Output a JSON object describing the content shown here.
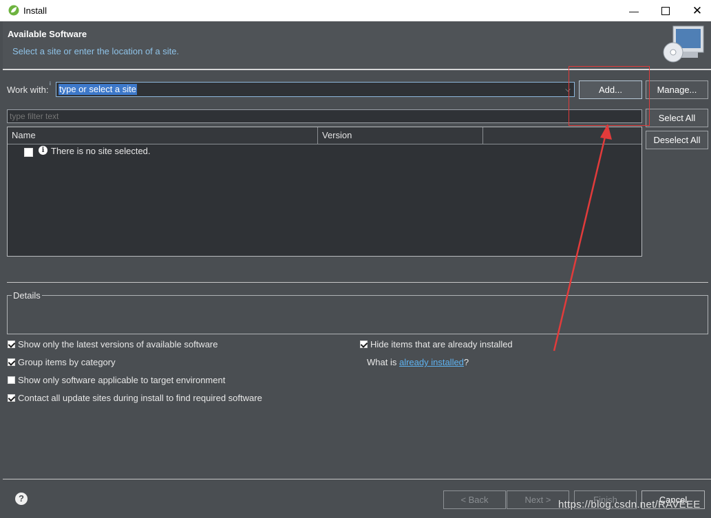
{
  "window": {
    "title": "Install",
    "minimize_icon": "minimize-icon",
    "maximize_icon": "maximize-icon",
    "close_icon": "close-icon"
  },
  "header": {
    "title": "Available Software",
    "subtitle": "Select a site or enter the location of a site."
  },
  "workwith": {
    "label": "Work with:",
    "info_mark": "i",
    "value": "type or select a site",
    "add_label": "Add...",
    "manage_label": "Manage..."
  },
  "filter": {
    "placeholder": "type filter text"
  },
  "side_buttons": {
    "select_all": "Select All",
    "deselect_all": "Deselect All"
  },
  "table": {
    "columns": [
      "Name",
      "Version",
      ""
    ],
    "rows": [
      {
        "checked": false,
        "icon": "info-icon",
        "text": "There is no site selected."
      }
    ]
  },
  "details": {
    "label": "Details"
  },
  "options": {
    "latest_versions": {
      "label": "Show only the latest versions of available software",
      "checked": true
    },
    "group_by_category": {
      "label": "Group items by category",
      "checked": true
    },
    "target_env": {
      "label": "Show only software applicable to target environment",
      "checked": false
    },
    "contact_sites": {
      "label": "Contact all update sites during install to find required software",
      "checked": true
    },
    "hide_installed": {
      "label": "Hide items that are already installed",
      "checked": true
    },
    "what_is_prefix": "What is ",
    "what_is_link": "already installed",
    "what_is_suffix": "?"
  },
  "footer": {
    "help_icon": "help-icon",
    "back": "< Back",
    "next": "Next >",
    "finish": "Finish",
    "cancel": "Cancel"
  },
  "watermark": "https://blog.csdn.net/RAVEEE",
  "colors": {
    "background": "#4a4e52",
    "link": "#5eb2f0",
    "annotation": "#e23b3b",
    "selection": "#3d78c9"
  }
}
